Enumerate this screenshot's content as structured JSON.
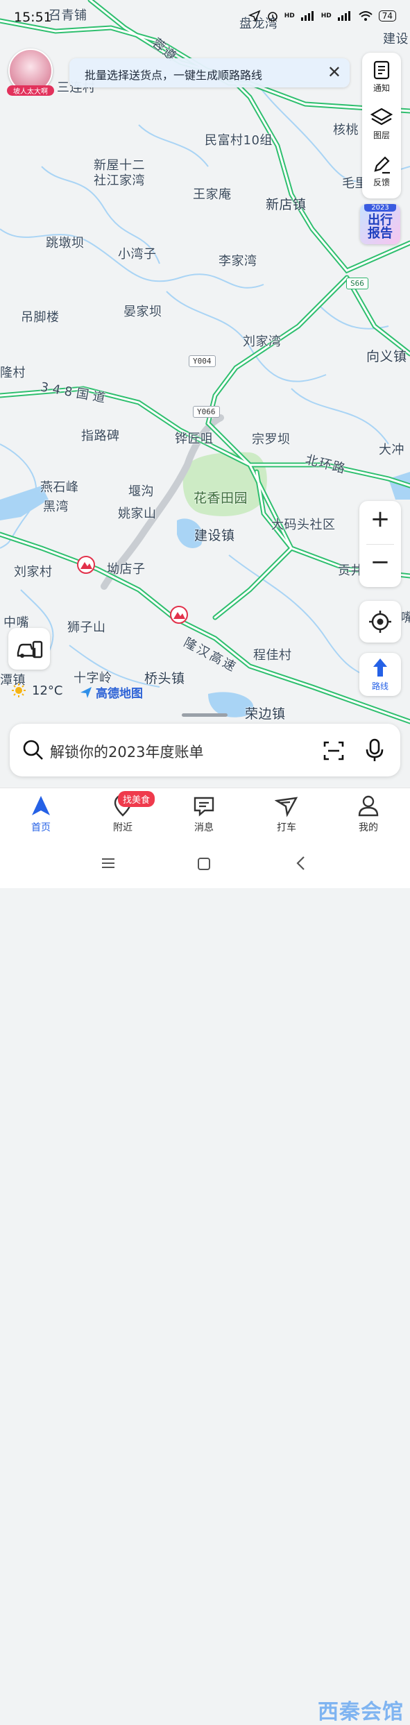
{
  "status_bar": {
    "time": "15:51",
    "battery": "74",
    "network1": "HD",
    "network2": "HD"
  },
  "banner": {
    "text": "批量选择送货点，一键生成顺路路线",
    "close": "✕"
  },
  "avatar": {
    "caption": "坡人太大啊"
  },
  "right_panel": {
    "notify": "通知",
    "layers": "图层",
    "feedback": "反馈"
  },
  "report": {
    "year": "2023",
    "line1": "出行",
    "line2": "报告"
  },
  "zoom": {
    "in": "+",
    "out": "−"
  },
  "route": {
    "label": "路线"
  },
  "weather": {
    "temp": "12°C"
  },
  "brand": {
    "name": "高德地图"
  },
  "search": {
    "placeholder": "解锁你的2023年度账单"
  },
  "tabs": [
    {
      "label": "首页"
    },
    {
      "label": "附近",
      "badge": "找美食"
    },
    {
      "label": "消息"
    },
    {
      "label": "打车"
    },
    {
      "label": "我的"
    }
  ],
  "watermark": "西秦会馆",
  "map": {
    "labels": {
      "l1": "召青铺",
      "l2": "盘龙湾",
      "l3": "建设",
      "l4": "三连村",
      "l5": "民富村10组",
      "l6": "核桃",
      "l7": "新屋十二",
      "l8": "社江家湾",
      "l9": "王家庵",
      "l10": "新店镇",
      "l11": "毛里",
      "l12": "跳墩坝",
      "l13": "小湾子",
      "l14": "李家湾",
      "l15": "吊脚楼",
      "l16": "晏家坝",
      "l17": "刘家湾",
      "l18": "向义镇",
      "l19": "隆村",
      "l20": "指路碑",
      "l21": "铧匠咀",
      "l22": "宗罗坝",
      "l23": "大冲",
      "l24": "燕石峰",
      "l25": "黑湾",
      "l26": "堰沟",
      "l27": "姚家山",
      "l28": "花香田园",
      "l29": "建设镇",
      "l30": "大码头社区",
      "l31": "刘家村",
      "l32": "坳店子",
      "l33": "贡井",
      "l34": "中嘴",
      "l35": "狮子山",
      "l36": "程佳村",
      "l37": "潭镇",
      "l38": "十字岭",
      "l39": "桥头镇",
      "l40": "荣边镇",
      "l41": "嘴"
    },
    "roads": {
      "r1": "348国道",
      "r2": "北环路",
      "r3": "隆汉高速",
      "r4": "蓉遵"
    },
    "shields": {
      "s1": "S66",
      "s2": "Y004",
      "s3": "Y066"
    }
  }
}
